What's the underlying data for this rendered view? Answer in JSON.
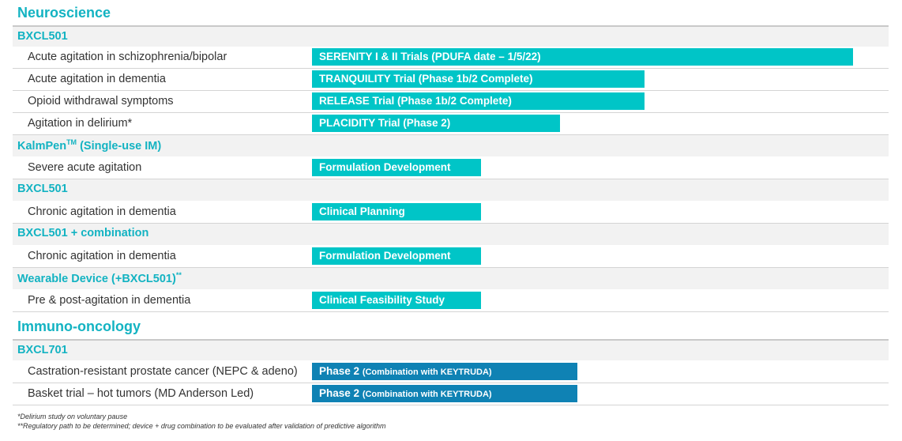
{
  "sections": [
    {
      "title": "Neuroscience"
    },
    {
      "title": "Immuno-oncology"
    }
  ],
  "groups": [
    {
      "name": "BXCL501"
    },
    {
      "name": "KalmPen",
      "sup": "TM",
      "suffix": " (Single-use IM)"
    },
    {
      "name": "BXCL501"
    },
    {
      "name": "BXCL501 + combination"
    },
    {
      "name": "Wearable Device (+BXCL501)",
      "sup": "**"
    },
    {
      "name": "BXCL701"
    }
  ],
  "rows": [
    {
      "indication": "Acute agitation in schizophrenia/bipolar",
      "status": "SERENITY I & II Trials (PDUFA date – 1/5/22)",
      "progress": 0.96
    },
    {
      "indication": "Acute agitation in dementia",
      "status": "TRANQUILITY Trial (Phase 1b/2 Complete)",
      "progress": 0.59
    },
    {
      "indication": "Opioid withdrawal symptoms",
      "status": "RELEASE Trial (Phase 1b/2 Complete)",
      "progress": 0.59
    },
    {
      "indication": "Agitation in delirium*",
      "status": "PLACIDITY Trial (Phase 2)",
      "progress": 0.44
    },
    {
      "indication": "Severe acute agitation",
      "status": "Formulation Development",
      "progress": 0.3
    },
    {
      "indication": "Chronic agitation in dementia",
      "status": "Clinical Planning",
      "progress": 0.3
    },
    {
      "indication": "Chronic agitation in dementia",
      "status": "Formulation Development",
      "progress": 0.3
    },
    {
      "indication": "Pre & post-agitation in dementia",
      "status": "Clinical Feasibility Study",
      "progress": 0.3
    },
    {
      "indication": "Castration-resistant prostate cancer (NEPC & adeno)",
      "status": "Phase 2",
      "status_note": "(Combination with KEYTRUDA)",
      "progress": 0.47
    },
    {
      "indication": "Basket trial – hot tumors (MD Anderson Led)",
      "status": "Phase 2",
      "status_note": "(Combination with KEYTRUDA)",
      "progress": 0.47
    }
  ],
  "footnotes": [
    "*Delirium study on voluntary pause",
    "**Regulatory path to be determined; device + drug combination to be evaluated after validation of predictive algorithm"
  ],
  "colors": {
    "accent": "#13b3c2",
    "bar_teal": "#00c5c7",
    "bar_blue": "#0f82b4",
    "group_bg": "#f2f2f2"
  }
}
